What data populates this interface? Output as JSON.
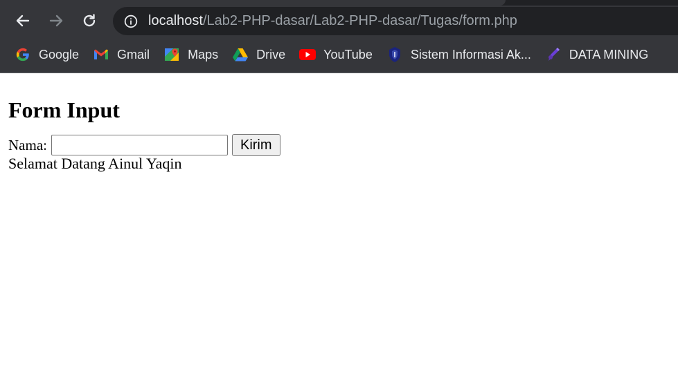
{
  "browser": {
    "url_host": "localhost",
    "url_path": "/Lab2-PHP-dasar/Lab2-PHP-dasar/Tugas/form.php",
    "bookmarks": [
      {
        "label": "Google",
        "icon": "google-icon"
      },
      {
        "label": "Gmail",
        "icon": "gmail-icon"
      },
      {
        "label": "Maps",
        "icon": "maps-icon"
      },
      {
        "label": "Drive",
        "icon": "drive-icon"
      },
      {
        "label": "YouTube",
        "icon": "youtube-icon"
      },
      {
        "label": "Sistem Informasi Ak...",
        "icon": "university-logo-icon"
      },
      {
        "label": "DATA MINING",
        "icon": "datamining-icon"
      }
    ]
  },
  "page": {
    "heading": "Form Input",
    "form": {
      "name_label": "Nama:",
      "name_value": "",
      "submit_label": "Kirim"
    },
    "welcome_message": "Selamat Datang Ainul Yaqin"
  },
  "colors": {
    "toolbar_bg": "#35363a",
    "omnibox_bg": "#202124",
    "url_text": "#9aa0a6",
    "url_host_text": "#e8eaed"
  }
}
